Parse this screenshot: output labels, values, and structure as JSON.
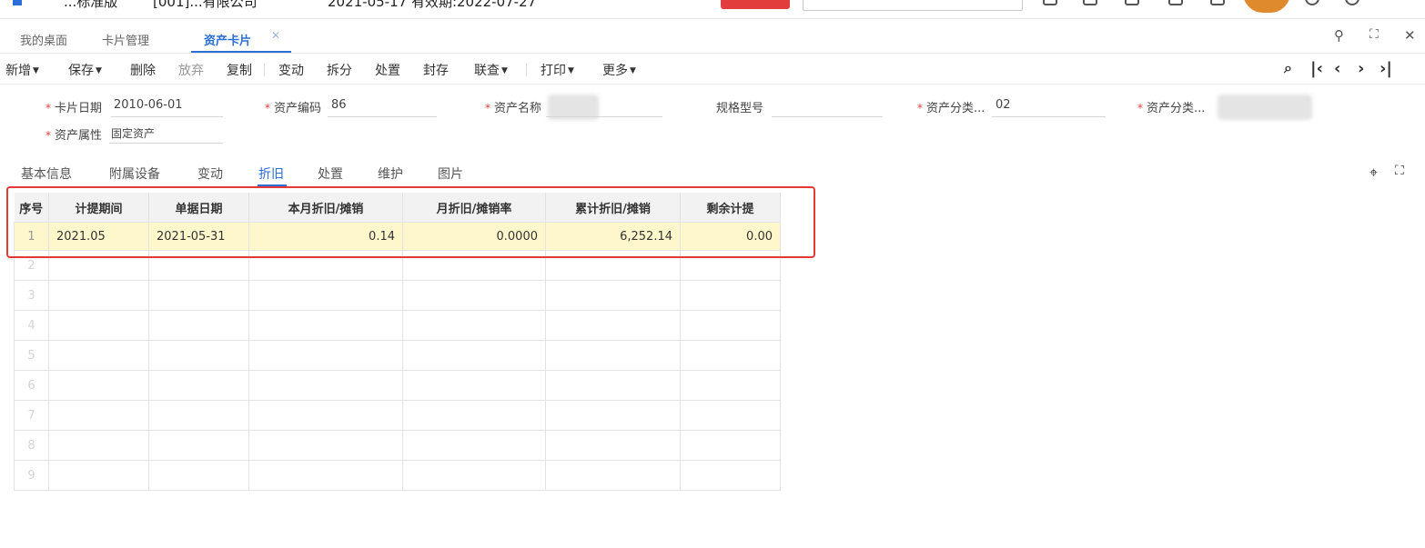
{
  "header": {
    "app_title": "...标准版",
    "company": "[001]...有限公司",
    "date_text": "2021-05-17  有效期:2022-07-27"
  },
  "tabs": [
    {
      "label": "我的桌面",
      "active": false
    },
    {
      "label": "卡片管理",
      "active": false
    },
    {
      "label": "资产卡片",
      "active": true
    }
  ],
  "tab_close": "✕",
  "toolbar": {
    "new": "新增",
    "save": "保存",
    "delete": "删除",
    "discard": "放弃",
    "copy": "复制",
    "change": "变动",
    "split": "拆分",
    "dispose": "处置",
    "seal": "封存",
    "query": "联查",
    "print": "打印",
    "more": "更多"
  },
  "form": {
    "card_date_label": "卡片日期",
    "card_date_value": "2010-06-01",
    "asset_code_label": "资产编码",
    "asset_code_value": "86",
    "asset_name_label": "资产名称",
    "spec_label": "规格型号",
    "category1_label": "资产分类...",
    "category1_value": "02",
    "category2_label": "资产分类...",
    "attr_label": "资产属性",
    "attr_value": "固定资产"
  },
  "subtabs": [
    "基本信息",
    "附属设备",
    "变动",
    "折旧",
    "处置",
    "维护",
    "图片"
  ],
  "subtab_active": 3,
  "grid": {
    "columns": [
      "序号",
      "计提期间",
      "单据日期",
      "本月折旧/摊销",
      "月折旧/摊销率",
      "累计折旧/摊销",
      "剩余计提"
    ],
    "rows": [
      {
        "idx": "1",
        "period": "2021.05",
        "date": "2021-05-31",
        "monthly": "0.14",
        "rate": "0.0000",
        "accum": "6,252.14",
        "remain": "0.00"
      }
    ],
    "empty_row_numbers": [
      "2",
      "3",
      "4",
      "5",
      "6",
      "7",
      "8",
      "9"
    ]
  },
  "colors": {
    "accent": "#2b6fd6",
    "highlight": "#e53935",
    "selected_row": "#fff7cc"
  }
}
